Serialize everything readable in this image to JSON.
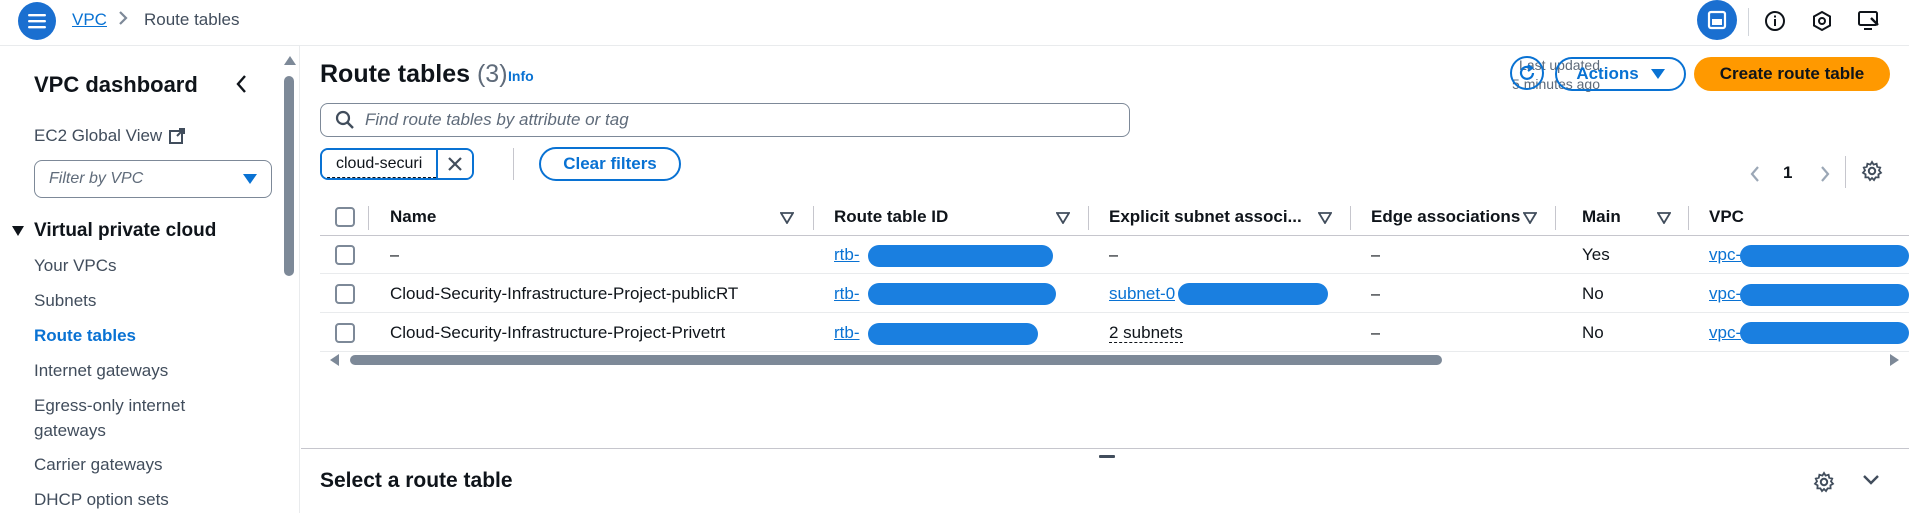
{
  "topbar": {
    "breadcrumb_root": "VPC",
    "breadcrumb_current": "Route tables"
  },
  "sidebar": {
    "title": "VPC dashboard",
    "ec2_global_view": "EC2 Global View",
    "filter_placeholder": "Filter by VPC",
    "section_label": "Virtual private cloud",
    "items": [
      {
        "label": "Your VPCs"
      },
      {
        "label": "Subnets"
      },
      {
        "label": "Route tables"
      },
      {
        "label": "Internet gateways"
      },
      {
        "label": "Egress-only internet gateways"
      },
      {
        "label": "Carrier gateways"
      },
      {
        "label": "DHCP option sets"
      }
    ],
    "active_item": "Route tables"
  },
  "main": {
    "title": "Route tables",
    "count": "(3)",
    "info_label": "Info",
    "last_updated_line1": "Last updated",
    "last_updated_line2": "5 minutes ago",
    "actions_label": "Actions",
    "create_label": "Create route table",
    "search_placeholder": "Find route tables by attribute or tag",
    "filter_token": "cloud-securi",
    "clear_filters_label": "Clear filters",
    "page_number": "1"
  },
  "table": {
    "columns": [
      "Name",
      "Route table ID",
      "Explicit subnet associ...",
      "Edge associations",
      "Main",
      "VPC"
    ],
    "rows": [
      {
        "name": "–",
        "route_table_id": "rtb-",
        "explicit_subnet": "–",
        "edge": "–",
        "main": "Yes",
        "vpc": "vpc-"
      },
      {
        "name": "Cloud-Security-Infrastructure-Project-publicRT",
        "route_table_id": "rtb-",
        "explicit_subnet": "subnet-0",
        "edge": "–",
        "main": "No",
        "vpc": "vpc-"
      },
      {
        "name": "Cloud-Security-Infrastructure-Project-Privetrt",
        "route_table_id": "rtb-",
        "explicit_subnet": "2 subnets",
        "edge": "–",
        "main": "No",
        "vpc": "vpc-"
      }
    ]
  },
  "details": {
    "title": "Select a route table"
  },
  "colors": {
    "accent": "#0972d3",
    "primary_button": "#ff9900",
    "active_icon_bg": "#1a6fd0",
    "redaction": "#1a7fe0"
  },
  "icons": [
    "menu-icon",
    "chevron-right-icon",
    "panel-icon",
    "info-icon",
    "notifications-icon",
    "feedback-icon",
    "chevron-left-icon",
    "external-link-icon",
    "search-icon",
    "close-icon",
    "refresh-icon",
    "settings-icon",
    "sort-caret-icon",
    "chevron-down-icon"
  ]
}
